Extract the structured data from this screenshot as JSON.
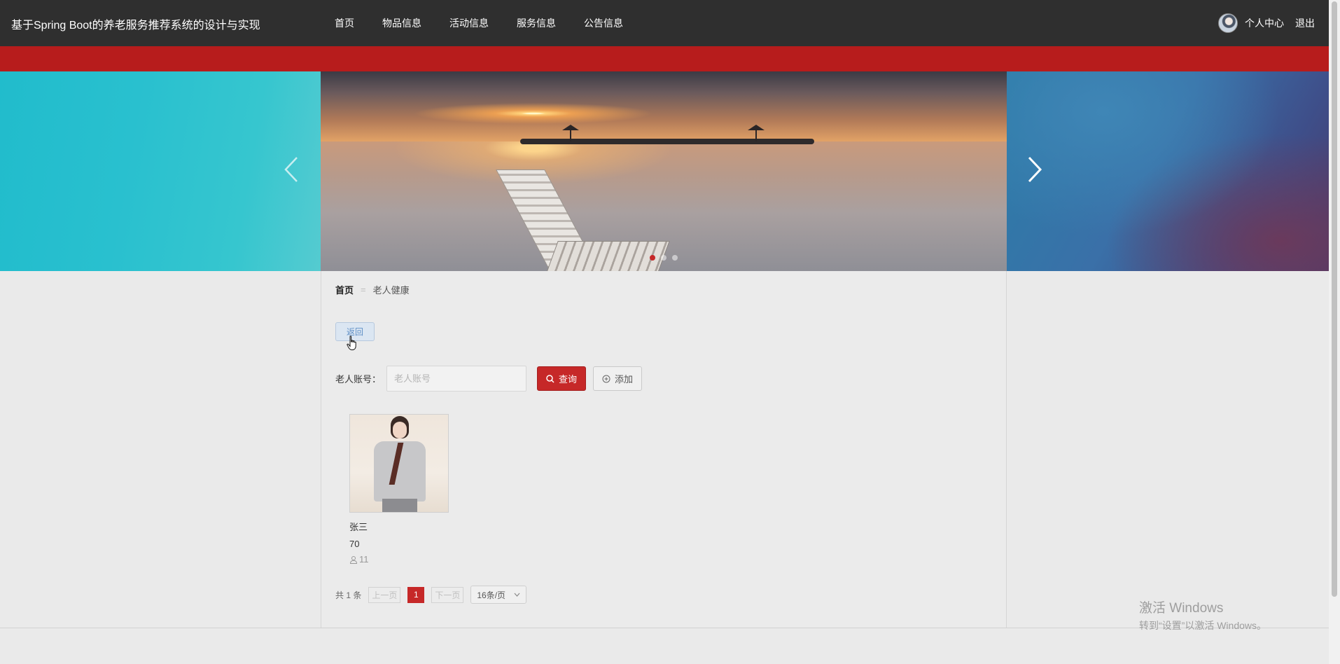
{
  "header": {
    "site_title": "基于Spring Boot的养老服务推荐系统的设计与实现",
    "nav": [
      {
        "label": "首页"
      },
      {
        "label": "物品信息"
      },
      {
        "label": "活动信息"
      },
      {
        "label": "服务信息"
      },
      {
        "label": "公告信息"
      }
    ],
    "user_center": "个人中心",
    "logout": "退出"
  },
  "carousel": {
    "slide_count": 3,
    "active_index": 0
  },
  "breadcrumb": {
    "home": "首页",
    "separator": "=",
    "current": "老人健康"
  },
  "back_button": "返回",
  "search": {
    "label": "老人账号：",
    "placeholder": "老人账号",
    "value": "",
    "query_button": "查询",
    "add_button": "添加"
  },
  "cards": [
    {
      "name": "张三",
      "age": "70",
      "views": "11",
      "icon": "user-icon"
    }
  ],
  "pagination": {
    "total_text": "共 1 条",
    "prev": "上一页",
    "current_page": "1",
    "next": "下一页",
    "page_size": "16条/页"
  },
  "watermark": {
    "title": "激活 Windows",
    "subtitle": "转到“设置”以激活 Windows。"
  },
  "colors": {
    "navbar": "#2f2f2f",
    "accent_red": "#b71c1c",
    "button_red": "#c62828",
    "page_bg": "#eaeaea"
  }
}
